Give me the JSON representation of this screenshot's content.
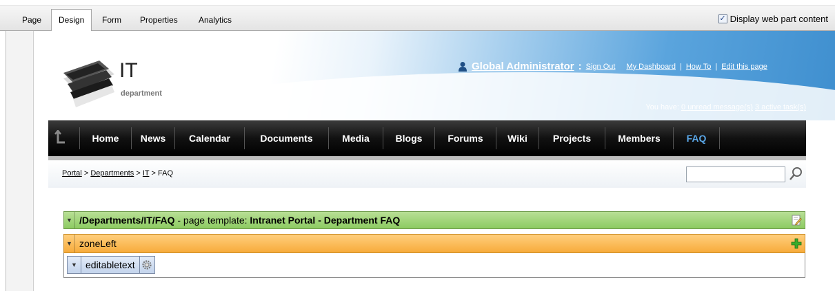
{
  "admin_tabs": {
    "items": [
      "Page",
      "Design",
      "Form",
      "Properties",
      "Analytics"
    ],
    "active": "Design",
    "display_option": {
      "label": "Display web part content",
      "checked": true
    }
  },
  "header": {
    "logo_title": "IT",
    "logo_subtitle": "department",
    "user": "Global Administrator",
    "user_separator": ":",
    "links": [
      "Sign Out",
      "My Dashboard",
      "How To",
      "Edit this page"
    ],
    "link_separator": "|",
    "you_have": "You have:",
    "unread": "0 unread message(s)",
    "tasks": "3 active task(s)"
  },
  "nav": {
    "items": [
      "Home",
      "News",
      "Calendar",
      "Documents",
      "Media",
      "Blogs",
      "Forums",
      "Wiki",
      "Projects",
      "Members",
      "FAQ"
    ],
    "active": "FAQ"
  },
  "breadcrumb": {
    "items": [
      "Portal",
      "Departments",
      "IT",
      "FAQ"
    ],
    "separator": ">"
  },
  "search": {
    "placeholder": ""
  },
  "template_bar": {
    "path": "/Departments/IT/FAQ",
    "middle": " - page template: ",
    "template": "Intranet Portal - Department FAQ"
  },
  "zone": {
    "name": "zoneLeft"
  },
  "webpart": {
    "name": "editabletext"
  },
  "colors": {
    "accent": "#5aa7e8",
    "zone": "#f7ab3b",
    "template": "#8dcb62"
  }
}
